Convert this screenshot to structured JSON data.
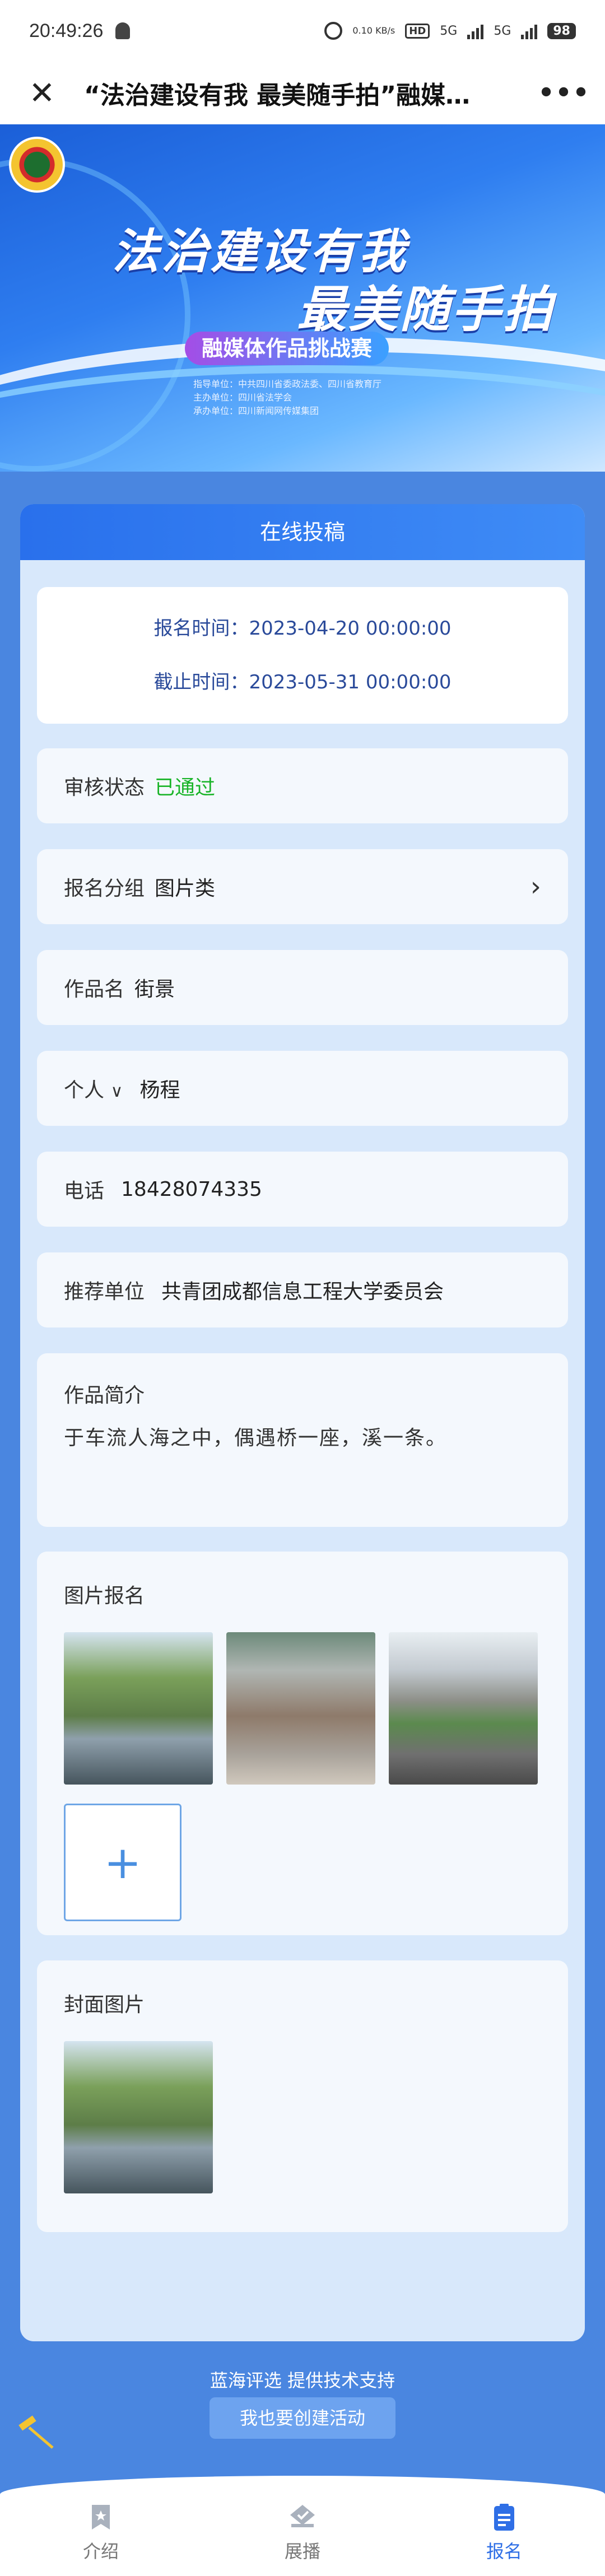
{
  "status_bar": {
    "time": "20:49:26",
    "speed": "0.10\nKB/s",
    "hd": "HD",
    "net1": "5G",
    "net2": "5G",
    "battery": "98"
  },
  "nav": {
    "title": "“法治建设有我 最美随手拍”融媒…"
  },
  "banner": {
    "title_line1": "法治建设有我",
    "title_line2": "最美随手拍",
    "subtitle": "融媒体作品挑战赛",
    "org_lines": [
      "指导单位：中共四川省委政法委、四川省教育厅",
      "主办单位：四川省法学会",
      "承办单位：四川新闻网传媒集团"
    ]
  },
  "panel": {
    "header": "在线投稿",
    "register_time_label": "报名时间：",
    "register_time": "2023-04-20 00:00:00",
    "deadline_label": "截止时间：",
    "deadline": "2023-05-31 00:00:00",
    "review_label": "审核状态",
    "review_status": "已通过",
    "group_label": "报名分组",
    "group_value": "图片类",
    "work_name_label": "作品名",
    "work_name": "街景",
    "type_label": "个人",
    "person_name": "杨程",
    "phone_label": "电话",
    "phone": "18428074335",
    "recommend_label": "推荐单位",
    "recommend_unit": "共青团成都信息工程大学委员会",
    "intro_label": "作品简介",
    "intro_text": "于车流人海之中，偶遇桥一座，溪一条。",
    "images_label": "图片报名",
    "add_symbol": "+",
    "cover_label": "封面图片"
  },
  "footer": {
    "support": "蓝海评选 提供技术支持",
    "create_button": "我也要创建活动"
  },
  "tabbar": {
    "tabs": [
      {
        "label": "介绍",
        "icon": "bookmark-icon"
      },
      {
        "label": "展播",
        "icon": "layers-icon"
      },
      {
        "label": "报名",
        "icon": "clipboard-icon"
      }
    ],
    "active_color": "#2f6fe6"
  }
}
